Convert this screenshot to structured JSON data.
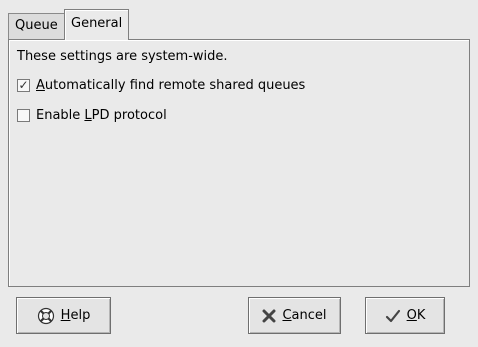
{
  "tabs": [
    {
      "label": "Queue",
      "active": false
    },
    {
      "label": "General",
      "active": true
    }
  ],
  "panel": {
    "description": "These settings are system-wide.",
    "options": [
      {
        "mnemonic": "A",
        "rest": "utomatically find remote shared queues",
        "checked": true
      },
      {
        "prefix": "Enable ",
        "mnemonic": "L",
        "rest": "PD protocol",
        "checked": false
      }
    ]
  },
  "buttons": {
    "help": {
      "mnemonic": "H",
      "rest": "elp",
      "icon": "help-icon"
    },
    "cancel": {
      "mnemonic": "C",
      "rest": "ancel",
      "icon": "cancel-x-icon"
    },
    "ok": {
      "mnemonic": "O",
      "rest": "K",
      "icon": "ok-check-icon"
    }
  },
  "colors": {
    "background": "#eaeaea",
    "border": "#7f7f7f"
  }
}
